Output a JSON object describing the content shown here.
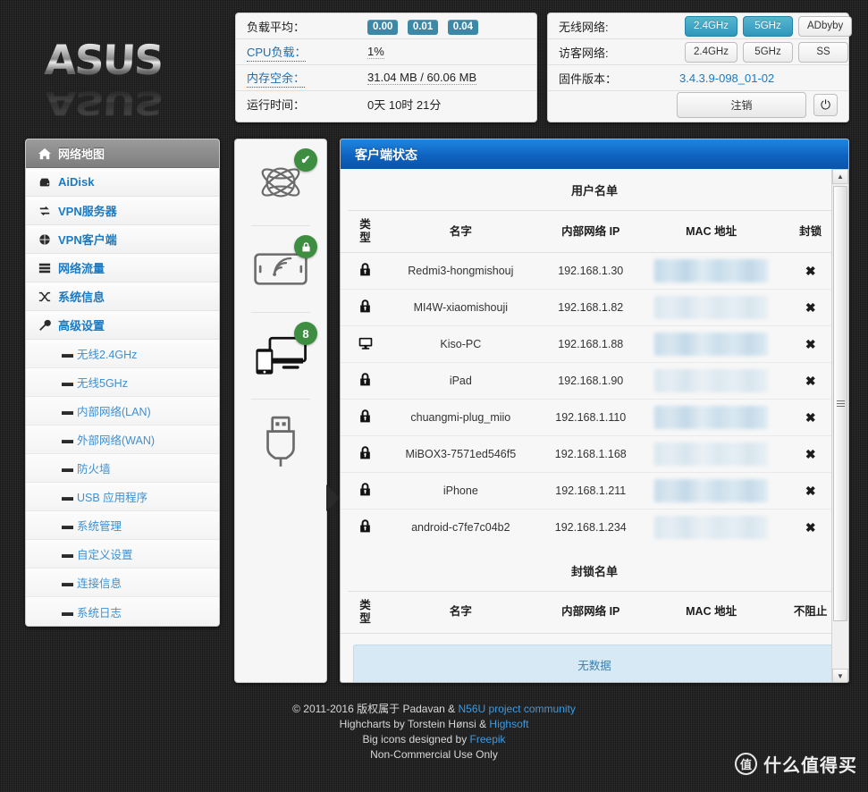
{
  "brand": {
    "logo_text": "ASUS"
  },
  "status_panel": {
    "rows": [
      {
        "label": "负载平均：",
        "type": "badges",
        "values": [
          "0.00",
          "0.01",
          "0.04"
        ]
      },
      {
        "label": "CPU负载：",
        "type": "text",
        "value": "1%",
        "label_link": true,
        "value_dotted": true
      },
      {
        "label": "内存空余：",
        "type": "text",
        "value": "31.04 MB / 60.06 MB",
        "label_link": true,
        "value_dotted": true
      },
      {
        "label": "运行时间：",
        "type": "text",
        "value": "0天 10时 21分"
      }
    ]
  },
  "wireless_panel": {
    "wireless_label": "无线网络:",
    "wireless_buttons": [
      {
        "label": "2.4GHz",
        "active": true
      },
      {
        "label": "5GHz",
        "active": true
      },
      {
        "label": "ADbyby",
        "active": false
      }
    ],
    "guest_label": "访客网络:",
    "guest_buttons": [
      {
        "label": "2.4GHz",
        "active": false
      },
      {
        "label": "5GHz",
        "active": false
      },
      {
        "label": "SS",
        "active": false
      }
    ],
    "firmware_label": "固件版本：",
    "firmware_value": "3.4.3.9-098_01-02",
    "logout_label": "注销",
    "power_icon": "⏻"
  },
  "sidebar": {
    "items": [
      {
        "label": "网络地图",
        "icon": "home-icon",
        "glyph": "⌂",
        "active": true
      },
      {
        "label": "AiDisk",
        "icon": "disk-icon",
        "glyph": "▤",
        "active": false
      },
      {
        "label": "VPN服务器",
        "icon": "vpn-server-icon",
        "glyph": "↻",
        "active": false
      },
      {
        "label": "VPN客户端",
        "icon": "globe-icon",
        "glyph": "◕",
        "active": false
      },
      {
        "label": "网络流量",
        "icon": "traffic-icon",
        "glyph": "≡",
        "active": false
      },
      {
        "label": "系统信息",
        "icon": "shuffle-icon",
        "glyph": "⇄",
        "active": false
      },
      {
        "label": "高级设置",
        "icon": "wrench-icon",
        "glyph": "🔧",
        "active": false
      }
    ],
    "subitems": [
      {
        "label": "无线2.4GHz"
      },
      {
        "label": "无线5GHz"
      },
      {
        "label": "内部网络(LAN)"
      },
      {
        "label": "外部网络(WAN)"
      },
      {
        "label": "防火墙"
      },
      {
        "label": "USB 应用程序"
      },
      {
        "label": "系统管理"
      },
      {
        "label": "自定义设置"
      },
      {
        "label": "连接信息"
      },
      {
        "label": "系统日志"
      }
    ]
  },
  "map_column": {
    "nodes": [
      {
        "icon": "internet-globe-icon",
        "badge": "✔",
        "badge_name": "internet-ok-badge"
      },
      {
        "icon": "wireless-router-icon",
        "badge": "lock",
        "badge_name": "wireless-secured-badge"
      },
      {
        "icon": "clients-devices-icon",
        "badge": "8",
        "badge_name": "client-count-badge"
      },
      {
        "icon": "usb-device-icon",
        "badge": null,
        "badge_name": null
      }
    ]
  },
  "main": {
    "header_title": "客户端状态",
    "user_list": {
      "title": "用户名单",
      "columns": [
        "类\n型",
        "名字",
        "内部网络 IP",
        "MAC 地址",
        "封锁"
      ],
      "col_type": "类 型",
      "col_name": "名字",
      "col_ip": "内部网络 IP",
      "col_mac": "MAC 地址",
      "col_action": "封锁",
      "rows": [
        {
          "type_icon": "lock-icon",
          "name": "Redmi3-hongmishouj",
          "ip": "192.168.1.30",
          "mac": "",
          "action": "✖"
        },
        {
          "type_icon": "lock-icon",
          "name": "MI4W-xiaomishouji",
          "ip": "192.168.1.82",
          "mac": "",
          "action": "✖"
        },
        {
          "type_icon": "monitor-icon",
          "name": "Kiso-PC",
          "ip": "192.168.1.88",
          "mac": "",
          "action": "✖"
        },
        {
          "type_icon": "lock-icon",
          "name": "iPad",
          "ip": "192.168.1.90",
          "mac": "",
          "action": "✖"
        },
        {
          "type_icon": "lock-icon",
          "name": "chuangmi-plug_miio",
          "ip": "192.168.1.110",
          "mac": "",
          "action": "✖"
        },
        {
          "type_icon": "lock-icon",
          "name": "MiBOX3-7571ed546f5",
          "ip": "192.168.1.168",
          "mac": "",
          "action": "✖"
        },
        {
          "type_icon": "lock-icon",
          "name": "iPhone",
          "ip": "192.168.1.211",
          "mac": "",
          "action": "✖"
        },
        {
          "type_icon": "lock-icon",
          "name": "android-c7fe7c04b2",
          "ip": "192.168.1.234",
          "mac": "",
          "action": "✖"
        }
      ]
    },
    "blocked_list": {
      "title": "封锁名单",
      "col_type": "类 型",
      "col_name": "名字",
      "col_ip": "内部网络 IP",
      "col_mac": "MAC 地址",
      "col_action": "不阻止",
      "empty_text": "无数据"
    }
  },
  "footer": {
    "line1_pre": "© 2011-2016 版权属于 Padavan & ",
    "line1_link": "N56U project community",
    "line2_pre": "Highcharts by Torstein Hønsi & ",
    "line2_link": "Highsoft",
    "line3_pre": "Big icons designed by ",
    "line3_link": "Freepik",
    "line4": "Non-Commercial Use Only"
  },
  "watermark": {
    "mark": "值",
    "text": "什么值得买"
  },
  "colors": {
    "background": "#262626",
    "accent_blue": "#0f63c0",
    "teal_badge": "#3d88a6",
    "teal_active": "#2f97bb",
    "link_blue": "#1a7ac4",
    "green_badge": "#3e8e41"
  }
}
